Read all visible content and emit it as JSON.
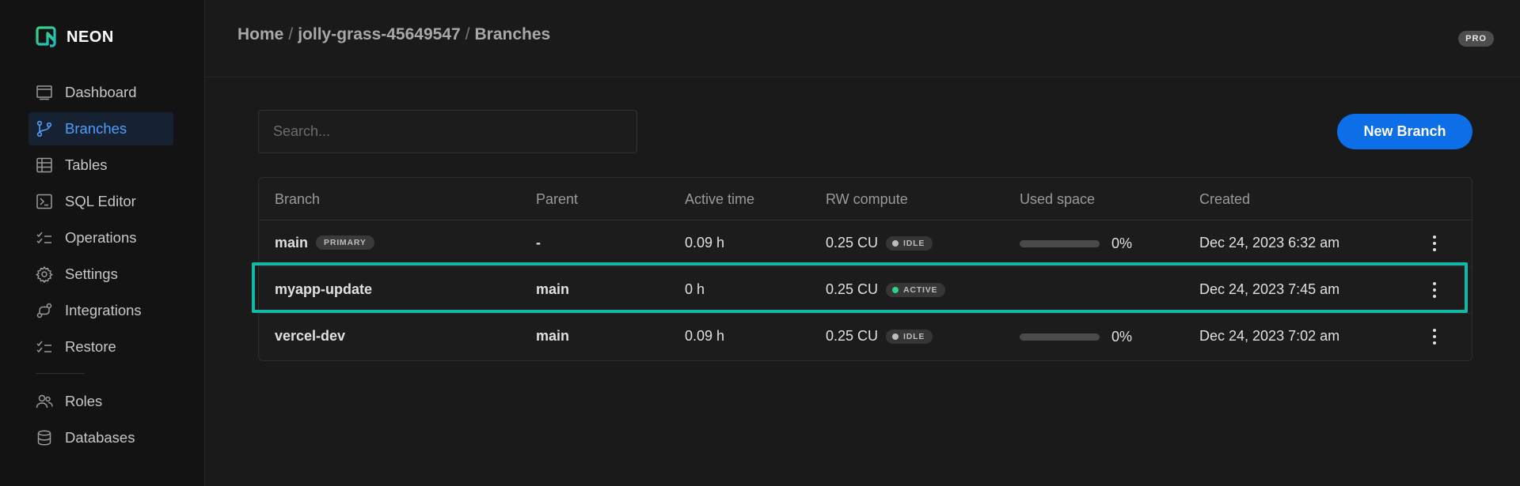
{
  "app": {
    "logo_text": "NEON",
    "colors": {
      "accent": "#0c6fe8",
      "active_nav": "#4d9dff",
      "highlight": "#14b8a6",
      "active_status": "#2bd48a"
    }
  },
  "sidebar": {
    "items": [
      {
        "label": "Dashboard",
        "icon": "dashboard-icon"
      },
      {
        "label": "Branches",
        "icon": "branch-icon",
        "active": true
      },
      {
        "label": "Tables",
        "icon": "table-icon"
      },
      {
        "label": "SQL Editor",
        "icon": "sql-editor-icon"
      },
      {
        "label": "Operations",
        "icon": "operations-icon"
      },
      {
        "label": "Settings",
        "icon": "gear-icon"
      },
      {
        "label": "Integrations",
        "icon": "integrations-icon"
      },
      {
        "label": "Restore",
        "icon": "restore-icon"
      },
      {
        "label": "Roles",
        "icon": "users-icon"
      },
      {
        "label": "Databases",
        "icon": "database-icon"
      }
    ]
  },
  "header": {
    "breadcrumb": [
      "Home",
      "jolly-grass-45649547",
      "Branches"
    ],
    "plan_badge": "PRO"
  },
  "toolbar": {
    "search_placeholder": "Search...",
    "new_branch_label": "New Branch"
  },
  "table": {
    "columns": [
      "Branch",
      "Parent",
      "Active time",
      "RW compute",
      "Used space",
      "Created"
    ],
    "rows": [
      {
        "branch": "main",
        "tag": "PRIMARY",
        "parent": "-",
        "active_time": "0.09 h",
        "compute": "0.25 CU",
        "status": "IDLE",
        "used_space": "0%",
        "used_fraction": 0,
        "created": "Dec 24, 2023 6:32 am"
      },
      {
        "branch": "myapp-update",
        "tag": "",
        "parent": "main",
        "active_time": "0 h",
        "compute": "0.25 CU",
        "status": "ACTIVE",
        "used_space": "",
        "created": "Dec 24, 2023 7:45 am"
      },
      {
        "branch": "vercel-dev",
        "tag": "",
        "parent": "main",
        "active_time": "0.09 h",
        "compute": "0.25 CU",
        "status": "IDLE",
        "used_space": "0%",
        "used_fraction": 0,
        "created": "Dec 24, 2023 7:02 am"
      }
    ]
  }
}
